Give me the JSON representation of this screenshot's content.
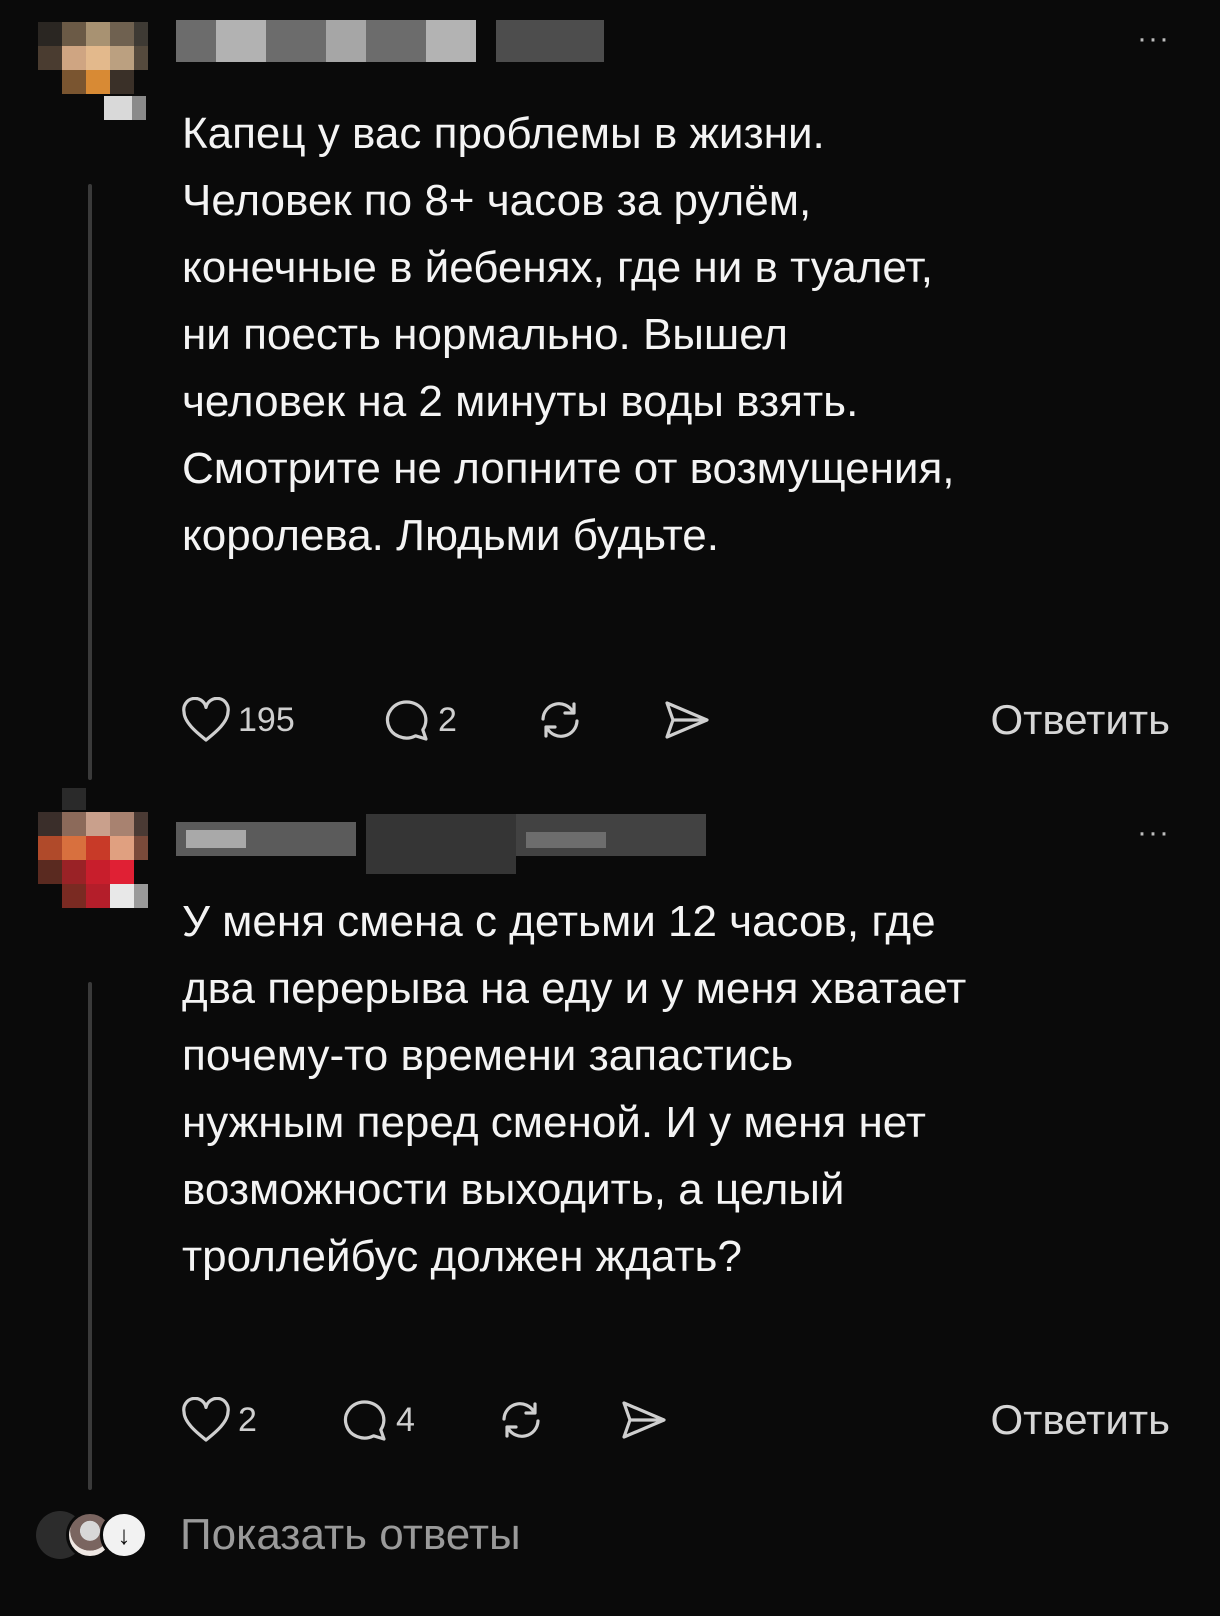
{
  "comments": [
    {
      "text": "Капец у вас проблемы в жизни.\nЧеловек по 8+ часов за рулём,\nконечные в йебенях, где ни в туалет,\nни поесть нормально. Вышел\nчеловек на 2 минуты воды взять.\nСмотрите не лопните от возмущения,\nкоролева. Людьми будьте.",
      "likes": "195",
      "comments_count": "2",
      "reply_label": "Ответить",
      "more_label": "···"
    },
    {
      "text": "У меня смена с детьми 12 часов, где\nдва перерыва на еду и у меня хватает\nпочему-то времени запастись\nнужным перед сменой. И у меня нет\nвозможности выходить, а целый\nтроллейбус должен ждать?",
      "likes": "2",
      "comments_count": "4",
      "reply_label": "Ответить",
      "more_label": "···"
    }
  ],
  "show_replies": {
    "label": "Показать ответы",
    "icon": "arrow-down-icon",
    "icon_glyph": "↓"
  },
  "icons": {
    "like": "heart-icon",
    "comment": "comment-bubble-icon",
    "repost": "repost-icon",
    "share": "send-icon",
    "more": "more-dots-icon"
  },
  "colors": {
    "background": "#0a0a0a",
    "text": "#f4f4f4",
    "muted": "#9a9a9a",
    "thread_line": "#3a3a3a"
  }
}
